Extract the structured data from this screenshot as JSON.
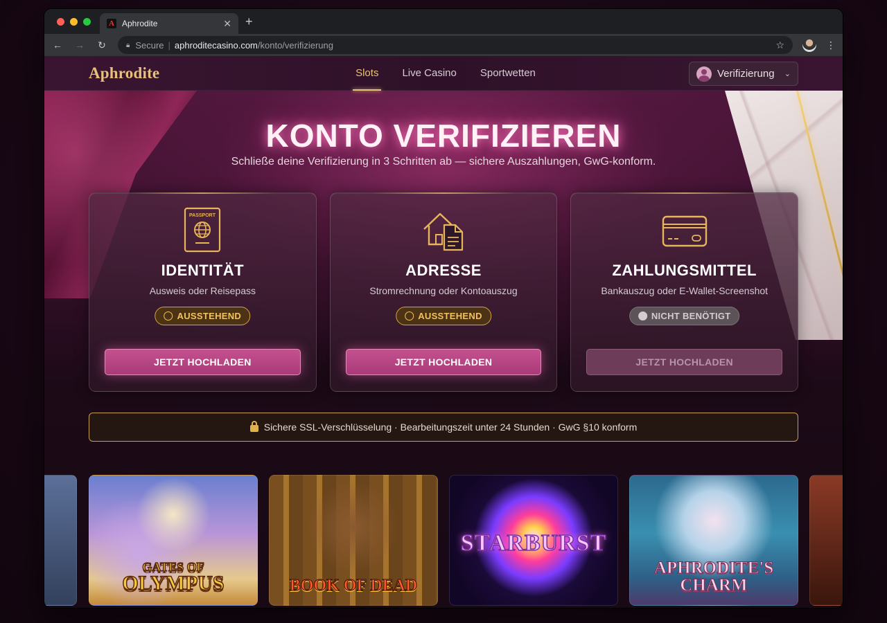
{
  "browser": {
    "tab_title": "Aphrodite",
    "tab_favicon": "A",
    "url_secure_label": "Secure",
    "url_host": "aphroditecasino.com",
    "url_path": "/konto/verifizierung"
  },
  "header": {
    "logo": "Aphrodite",
    "nav": [
      "Slots",
      "Live Casino",
      "Sportwetten"
    ],
    "active_nav": "Slots",
    "account_button": "Verifizierung"
  },
  "hero": {
    "title": "KONTO VERIFIZIEREN",
    "subtitle": "Schließe deine Verifizierung in 3 Schritten ab — sichere Auszahlungen, GwG-konform."
  },
  "cards": [
    {
      "icon": "passport-icon",
      "icon_text": "PASSPORT",
      "title": "IDENTITÄT",
      "desc": "Ausweis oder Reisepass",
      "status": "AUSSTEHEND",
      "status_icon": "clock-icon",
      "button": "JETZT HOCHLADEN",
      "enabled": true
    },
    {
      "icon": "house-document-icon",
      "title": "ADRESSE",
      "desc": "Stromrechnung oder Kontoauszug",
      "status": "AUSSTEHEND",
      "status_icon": "clock-icon",
      "button": "JETZT HOCHLADEN",
      "enabled": true
    },
    {
      "icon": "credit-card-icon",
      "title": "ZAHLUNGSMITTEL",
      "desc": "Bankauszug oder E-Wallet-Screenshot",
      "status": "NICHT BENÖTIGT",
      "status_icon": "check-circle-icon",
      "button": "JETZT HOCHLADEN",
      "enabled": false
    }
  ],
  "notice": "Sichere SSL-Verschlüsselung · Bearbeitungszeit unter 24 Stunden · GwG §10 konform",
  "games": [
    {
      "line1": "GATES OF",
      "line2": "OLYMPUS"
    },
    {
      "line1": "BOOK OF DEAD",
      "line2": ""
    },
    {
      "line1": "STARBURST",
      "line2": ""
    },
    {
      "line1": "APHRODITE'S",
      "line2": "CHARM"
    }
  ],
  "colors": {
    "gold": "#e9c37a",
    "pink_button": "#c4508f",
    "pending": "#f1c25f"
  }
}
